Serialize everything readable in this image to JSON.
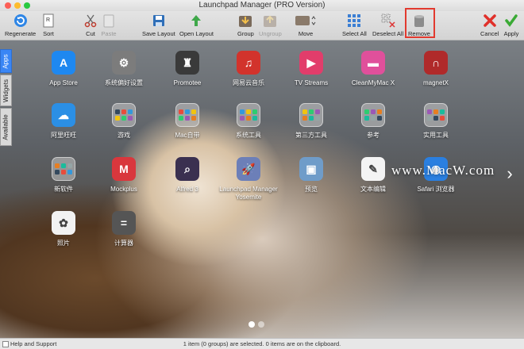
{
  "window": {
    "title": "Launchpad Manager (PRO Version)"
  },
  "toolbar": {
    "regenerate": "Regenerate",
    "sort": "Sort",
    "cut": "Cut",
    "paste": "Paste",
    "save_layout": "Save Layout",
    "open_layout": "Open Layout",
    "group": "Group",
    "ungroup": "Ungroup",
    "move": "Move",
    "select_all": "Select All",
    "deselect_all": "Deselect All",
    "remove": "Remove",
    "cancel": "Cancel",
    "apply": "Apply"
  },
  "side_tabs": [
    "Apps",
    "Widgets",
    "Available"
  ],
  "apps": [
    {
      "name": "App Store",
      "icon": "app-store-icon",
      "color": "#1e88f0",
      "glyph": "A"
    },
    {
      "name": "系统偏好设置",
      "icon": "system-preferences-icon",
      "color": "#7c7c7c",
      "glyph": "⚙"
    },
    {
      "name": "Promotee",
      "icon": "promotee-icon",
      "color": "#3a3a3a",
      "glyph": "♜"
    },
    {
      "name": "网易云音乐",
      "icon": "netease-music-icon",
      "color": "#d2332c",
      "glyph": "♫"
    },
    {
      "name": "TV Streams",
      "icon": "tv-streams-icon",
      "color": "#e23d6b",
      "glyph": "▶"
    },
    {
      "name": "CleanMyMac X",
      "icon": "cleanmymac-icon",
      "color": "#e0509b",
      "glyph": "▬"
    },
    {
      "name": "magnetX",
      "icon": "magnetx-icon",
      "color": "#b02a2a",
      "glyph": "∩"
    },
    {
      "name": "阿里旺旺",
      "icon": "aliwangwang-icon",
      "color": "#2b8fe5",
      "glyph": "☁"
    },
    {
      "name": "游戏",
      "icon": "folder-icon",
      "folder": true
    },
    {
      "name": "Mac自带",
      "icon": "folder-icon",
      "folder": true
    },
    {
      "name": "系统工具",
      "icon": "folder-icon",
      "folder": true
    },
    {
      "name": "第三方工具",
      "icon": "folder-icon",
      "folder": true
    },
    {
      "name": "参考",
      "icon": "folder-icon",
      "folder": true
    },
    {
      "name": "实用工具",
      "icon": "folder-icon",
      "folder": true
    },
    {
      "name": "新软件",
      "icon": "folder-icon",
      "folder": true
    },
    {
      "name": "Mockplus",
      "icon": "mockplus-icon",
      "color": "#d9373d",
      "glyph": "M"
    },
    {
      "name": "Alfred 3",
      "icon": "alfred-icon",
      "color": "#3a3050",
      "glyph": "⌕"
    },
    {
      "name": "Launchpad Manager Yosemite",
      "icon": "launchpad-manager-icon",
      "color": "#6c7fb8",
      "glyph": "🚀"
    },
    {
      "name": "预览",
      "icon": "preview-icon",
      "color": "#6f9cc9",
      "glyph": "▣"
    },
    {
      "name": "文本编辑",
      "icon": "textedit-icon",
      "color": "#f4f4f4",
      "glyph": "✎"
    },
    {
      "name": "Safari 浏览器",
      "icon": "safari-icon",
      "color": "#2a7fe0",
      "glyph": "◉"
    },
    {
      "name": "照片",
      "icon": "photos-icon",
      "color": "#f2f2f2",
      "glyph": "✿"
    },
    {
      "name": "计算器",
      "icon": "calculator-icon",
      "color": "#555555",
      "glyph": "="
    }
  ],
  "watermark": "www.MacW.com",
  "status": {
    "help": "Help and Support",
    "message": "1 item (0 groups) are selected. 0 items are on the clipboard."
  }
}
